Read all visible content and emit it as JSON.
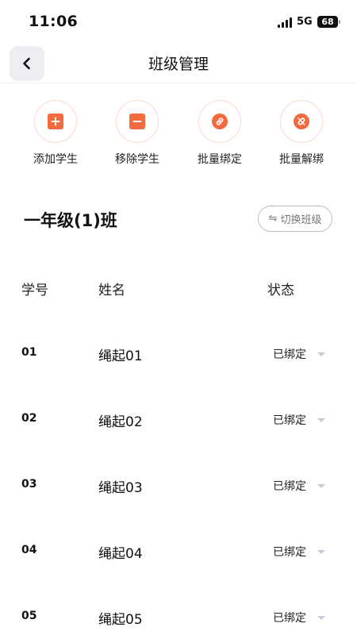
{
  "status_bar": {
    "time": "11:06",
    "network": "5G",
    "battery": "68"
  },
  "nav": {
    "title": "班级管理",
    "back_icon": "chevron-left-icon"
  },
  "actions": [
    {
      "label": "添加学生",
      "icon": "plus-icon"
    },
    {
      "label": "移除学生",
      "icon": "minus-icon"
    },
    {
      "label": "批量绑定",
      "icon": "link-icon"
    },
    {
      "label": "批量解绑",
      "icon": "unlink-icon"
    }
  ],
  "class_header": {
    "name": "一年级(1)班",
    "switch_label": "切换班级",
    "switch_icon": "swap-icon"
  },
  "table": {
    "headers": {
      "number": "学号",
      "name": "姓名",
      "status": "状态"
    },
    "rows": [
      {
        "number": "01",
        "name": "绳起01",
        "status": "已绑定"
      },
      {
        "number": "02",
        "name": "绳起02",
        "status": "已绑定"
      },
      {
        "number": "03",
        "name": "绳起03",
        "status": "已绑定"
      },
      {
        "number": "04",
        "name": "绳起04",
        "status": "已绑定"
      },
      {
        "number": "05",
        "name": "绳起05",
        "status": "已绑定"
      }
    ]
  },
  "colors": {
    "accent": "#f26a3d",
    "accent_border": "#fbd9cc",
    "caret": "#c7c8d8"
  }
}
